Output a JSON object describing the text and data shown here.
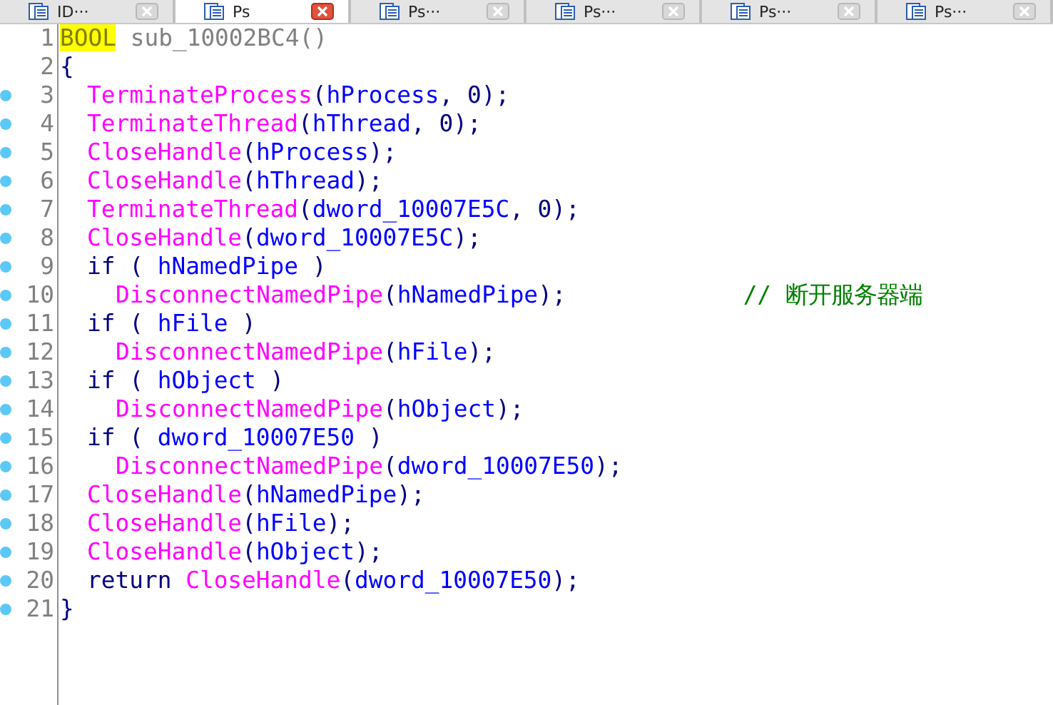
{
  "tabs": [
    {
      "label": "ID···",
      "selected": false
    },
    {
      "label": "Ps",
      "selected": true
    },
    {
      "label": "Ps···",
      "selected": false
    },
    {
      "label": "Ps···",
      "selected": false
    },
    {
      "label": "Ps···",
      "selected": false
    },
    {
      "label": "Ps···",
      "selected": false
    }
  ],
  "code_lines": [
    {
      "number": "1",
      "marker": false,
      "kind": "outer",
      "tokens": [
        {
          "kind": "type",
          "text": "BOOL"
        },
        {
          "kind": "name",
          "text": " sub_10002BC4()"
        }
      ]
    },
    {
      "number": "2",
      "marker": false,
      "kind": "outer",
      "tokens": [
        {
          "kind": "plain",
          "text": "{"
        }
      ]
    },
    {
      "number": "3",
      "marker": true,
      "kind": "body",
      "tokens": [
        {
          "kind": "func",
          "text": "TerminateProcess"
        },
        {
          "kind": "plain",
          "text": "("
        },
        {
          "kind": "ident",
          "text": "hProcess"
        },
        {
          "kind": "plain",
          "text": ", 0);"
        }
      ]
    },
    {
      "number": "4",
      "marker": true,
      "kind": "body",
      "tokens": [
        {
          "kind": "func",
          "text": "TerminateThread"
        },
        {
          "kind": "plain",
          "text": "("
        },
        {
          "kind": "ident",
          "text": "hThread"
        },
        {
          "kind": "plain",
          "text": ", 0);"
        }
      ]
    },
    {
      "number": "5",
      "marker": true,
      "kind": "body",
      "tokens": [
        {
          "kind": "func",
          "text": "CloseHandle"
        },
        {
          "kind": "plain",
          "text": "("
        },
        {
          "kind": "ident",
          "text": "hProcess"
        },
        {
          "kind": "plain",
          "text": ");"
        }
      ]
    },
    {
      "number": "6",
      "marker": true,
      "kind": "body",
      "tokens": [
        {
          "kind": "func",
          "text": "CloseHandle"
        },
        {
          "kind": "plain",
          "text": "("
        },
        {
          "kind": "ident",
          "text": "hThread"
        },
        {
          "kind": "plain",
          "text": ");"
        }
      ]
    },
    {
      "number": "7",
      "marker": true,
      "kind": "body",
      "tokens": [
        {
          "kind": "func",
          "text": "TerminateThread"
        },
        {
          "kind": "plain",
          "text": "("
        },
        {
          "kind": "ident",
          "text": "dword_10007E5C"
        },
        {
          "kind": "plain",
          "text": ", 0);"
        }
      ]
    },
    {
      "number": "8",
      "marker": true,
      "kind": "body",
      "tokens": [
        {
          "kind": "func",
          "text": "CloseHandle"
        },
        {
          "kind": "plain",
          "text": "("
        },
        {
          "kind": "ident",
          "text": "dword_10007E5C"
        },
        {
          "kind": "plain",
          "text": ");"
        }
      ]
    },
    {
      "number": "9",
      "marker": true,
      "kind": "body",
      "tokens": [
        {
          "kind": "plain",
          "text": "if ( "
        },
        {
          "kind": "ident",
          "text": "hNamedPipe"
        },
        {
          "kind": "plain",
          "text": " )"
        }
      ]
    },
    {
      "number": "10",
      "marker": true,
      "kind": "branch",
      "tokens": [
        {
          "kind": "func",
          "text": "DisconnectNamedPipe"
        },
        {
          "kind": "plain",
          "text": "("
        },
        {
          "kind": "ident",
          "text": "hNamedPipe"
        },
        {
          "kind": "plain",
          "text": ");"
        },
        {
          "kind": "comment",
          "text": "// 断开服务器端"
        }
      ]
    },
    {
      "number": "11",
      "marker": true,
      "kind": "body",
      "tokens": [
        {
          "kind": "plain",
          "text": "if ( "
        },
        {
          "kind": "ident",
          "text": "hFile"
        },
        {
          "kind": "plain",
          "text": " )"
        }
      ]
    },
    {
      "number": "12",
      "marker": true,
      "kind": "branch",
      "tokens": [
        {
          "kind": "func",
          "text": "DisconnectNamedPipe"
        },
        {
          "kind": "plain",
          "text": "("
        },
        {
          "kind": "ident",
          "text": "hFile"
        },
        {
          "kind": "plain",
          "text": ");"
        }
      ]
    },
    {
      "number": "13",
      "marker": true,
      "kind": "body",
      "tokens": [
        {
          "kind": "plain",
          "text": "if ( "
        },
        {
          "kind": "ident",
          "text": "hObject"
        },
        {
          "kind": "plain",
          "text": " )"
        }
      ]
    },
    {
      "number": "14",
      "marker": true,
      "kind": "branch",
      "tokens": [
        {
          "kind": "func",
          "text": "DisconnectNamedPipe"
        },
        {
          "kind": "plain",
          "text": "("
        },
        {
          "kind": "ident",
          "text": "hObject"
        },
        {
          "kind": "plain",
          "text": ");"
        }
      ]
    },
    {
      "number": "15",
      "marker": true,
      "kind": "body",
      "tokens": [
        {
          "kind": "plain",
          "text": "if ( "
        },
        {
          "kind": "ident",
          "text": "dword_10007E50"
        },
        {
          "kind": "plain",
          "text": " )"
        }
      ]
    },
    {
      "number": "16",
      "marker": true,
      "kind": "branch",
      "tokens": [
        {
          "kind": "func",
          "text": "DisconnectNamedPipe"
        },
        {
          "kind": "plain",
          "text": "("
        },
        {
          "kind": "ident",
          "text": "dword_10007E50"
        },
        {
          "kind": "plain",
          "text": ");"
        }
      ]
    },
    {
      "number": "17",
      "marker": true,
      "kind": "body",
      "tokens": [
        {
          "kind": "func",
          "text": "CloseHandle"
        },
        {
          "kind": "plain",
          "text": "("
        },
        {
          "kind": "ident",
          "text": "hNamedPipe"
        },
        {
          "kind": "plain",
          "text": ");"
        }
      ]
    },
    {
      "number": "18",
      "marker": true,
      "kind": "body",
      "tokens": [
        {
          "kind": "func",
          "text": "CloseHandle"
        },
        {
          "kind": "plain",
          "text": "("
        },
        {
          "kind": "ident",
          "text": "hFile"
        },
        {
          "kind": "plain",
          "text": ");"
        }
      ]
    },
    {
      "number": "19",
      "marker": true,
      "kind": "body",
      "tokens": [
        {
          "kind": "func",
          "text": "CloseHandle"
        },
        {
          "kind": "plain",
          "text": "("
        },
        {
          "kind": "ident",
          "text": "hObject"
        },
        {
          "kind": "plain",
          "text": ");"
        }
      ]
    },
    {
      "number": "20",
      "marker": true,
      "kind": "body",
      "tokens": [
        {
          "kind": "plain",
          "text": "return "
        },
        {
          "kind": "func",
          "text": "CloseHandle"
        },
        {
          "kind": "plain",
          "text": "("
        },
        {
          "kind": "ident",
          "text": "dword_10007E50"
        },
        {
          "kind": "plain",
          "text": ");"
        }
      ]
    },
    {
      "number": "21",
      "marker": true,
      "kind": "outer",
      "tokens": [
        {
          "kind": "plain",
          "text": "}"
        }
      ]
    }
  ]
}
